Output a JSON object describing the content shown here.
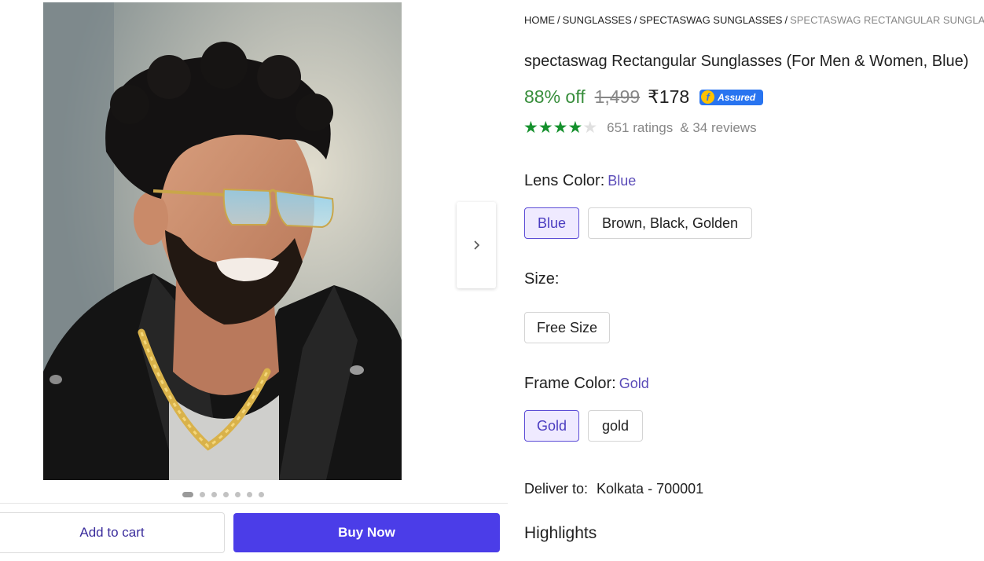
{
  "breadcrumb": [
    "HOME",
    "SUNGLASSES",
    "SPECTASWAG SUNGLASSES",
    "SPECTASWAG RECTANGULAR SUNGLASSES"
  ],
  "product": {
    "title": "spectaswag Rectangular Sunglasses (For Men & Women, Blue)",
    "discount": "88% off",
    "mrp": "1,499",
    "price": "₹178",
    "assured_label": "Assured",
    "assured_icon_letter": "f",
    "rating": 4,
    "rating_max": 5,
    "ratings_count": "651 ratings",
    "reviews_count": "& 34 reviews"
  },
  "lens_color": {
    "label": "Lens Color:",
    "selected": "Blue",
    "options": [
      "Blue",
      "Brown, Black, Golden"
    ]
  },
  "size": {
    "label": "Size:",
    "options": [
      "Free Size"
    ]
  },
  "frame_color": {
    "label": "Frame Color:",
    "selected": "Gold",
    "options": [
      "Gold",
      "gold"
    ]
  },
  "delivery": {
    "label": "Deliver to:",
    "location": "Kolkata - 700001"
  },
  "highlights_label": "Highlights",
  "gallery": {
    "image_count": 7,
    "active_index": 0,
    "next_icon": "chevron-right-icon"
  },
  "actions": {
    "add_to_cart": "Add to cart",
    "buy_now": "Buy Now"
  },
  "colors": {
    "accent": "#4b3de8",
    "discount_green": "#388e3c",
    "star_green": "#14902c",
    "assured_blue": "#2874f0"
  }
}
